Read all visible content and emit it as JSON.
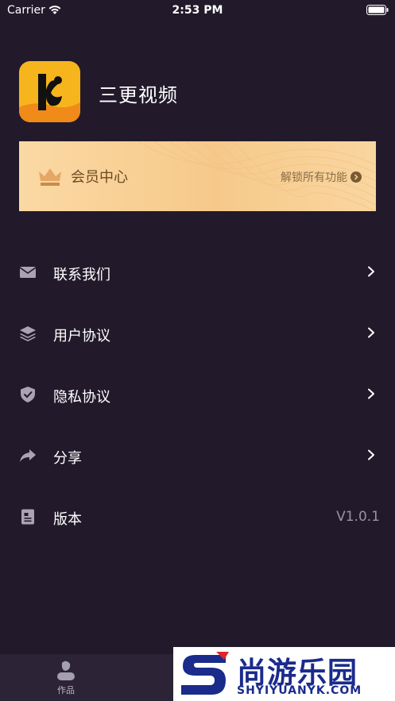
{
  "status_bar": {
    "carrier": "Carrier",
    "time": "2:53 PM"
  },
  "app": {
    "name": "三更视频"
  },
  "vip": {
    "label": "会员中心",
    "action": "解锁所有功能"
  },
  "menu": {
    "items": [
      {
        "label": "联系我们",
        "icon": "mail-icon"
      },
      {
        "label": "用户协议",
        "icon": "layers-icon"
      },
      {
        "label": "隐私协议",
        "icon": "shield-check-icon"
      },
      {
        "label": "分享",
        "icon": "share-arrow-icon"
      },
      {
        "label": "版本",
        "icon": "document-icon",
        "value": "V1.0.1"
      }
    ]
  },
  "tab_bar": {
    "works_label": "作品"
  },
  "watermark": {
    "name": "尚游乐园",
    "domain": "SHYIYUANYK.COM"
  },
  "colors": {
    "background": "#221a2b",
    "vip_gold": "#f6c98a",
    "vip_text": "#6b4a22",
    "logo_yellow": "#f6b51d",
    "tab_bar": "#2c2336"
  }
}
